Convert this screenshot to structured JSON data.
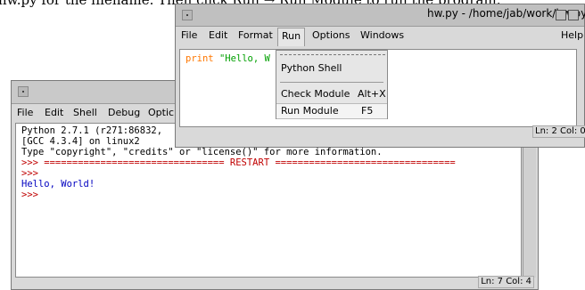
{
  "doc_text": "hw.py for the filename. Then click Run → Run Module to run the program.",
  "shell": {
    "menus": [
      "File",
      "Edit",
      "Shell",
      "Debug",
      "Optic"
    ],
    "lines": [
      {
        "text": "Python 2.7.1 (r271:86832,",
        "color": "black"
      },
      {
        "text": "[GCC 4.3.4] on linux2",
        "color": "black"
      },
      {
        "text": "Type \"copyright\", \"credits\" or \"license()\" for more information.",
        "color": "black"
      },
      {
        "text": ">>> ================================ RESTART ================================",
        "color": "red"
      },
      {
        "text": ">>>",
        "color": "red"
      },
      {
        "text": "Hello, World!",
        "color": "blue"
      },
      {
        "text": ">>>",
        "color": "red"
      }
    ],
    "status": "Ln: 7 Col: 4"
  },
  "editor": {
    "title": "hw.py - /home/jab/work/hw.py",
    "menus": [
      "File",
      "Edit",
      "Format",
      "Run",
      "Options",
      "Windows"
    ],
    "help_menu": "Help",
    "code": {
      "kw": "print",
      "str": "\"Hello, W"
    },
    "status": "Ln: 2 Col: 0"
  },
  "run_menu": {
    "items": [
      {
        "label": "Python Shell",
        "accel": ""
      },
      {
        "label": "Check Module",
        "accel": "Alt+X"
      },
      {
        "label": "Run Module",
        "accel": "F5"
      }
    ]
  }
}
